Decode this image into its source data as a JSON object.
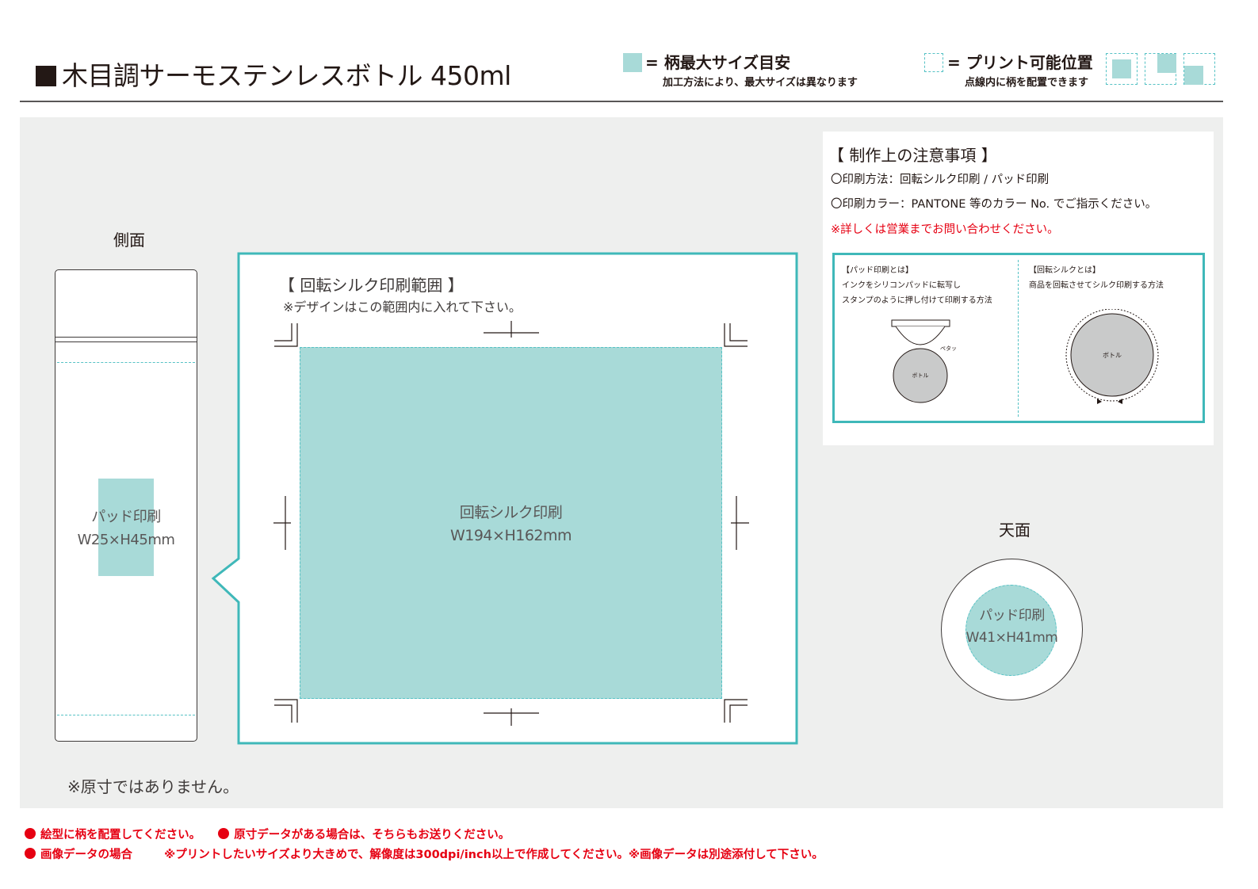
{
  "header": {
    "title": "木目調サーモステンレスボトル 450ml",
    "legend_max_size": "= 柄最大サイズ目安",
    "legend_max_size_note": "加工方法により、最大サイズは異なります",
    "legend_print_position": "= プリント可能位置",
    "legend_print_position_note": "点線内に柄を配置できます"
  },
  "side_view": {
    "label": "側面",
    "print_name": "パッド印刷",
    "print_size": "W25×H45mm"
  },
  "rotary_panel": {
    "title": "【 回転シルク印刷範囲 】",
    "subtitle": "※デザインはこの範囲内に入れて下さい。",
    "print_name": "回転シルク印刷",
    "print_size": "W194×H162mm"
  },
  "notes": {
    "title": "【 制作上の注意事項 】",
    "method": "〇印刷方法：回転シルク印刷 / パッド印刷",
    "color": "〇印刷カラー：PANTONE 等のカラー No. でご指示ください。",
    "contact": "※詳しくは営業までお問い合わせください。"
  },
  "info_box": {
    "pad_title": "【パッド印刷とは】",
    "pad_line1": "インクをシリコンパッドに転写し",
    "pad_line2": "スタンプのように押し付けて印刷する方法",
    "pad_sound": "ペタッ",
    "pad_bottle": "ボトル",
    "rotary_title": "【回転シルクとは】",
    "rotary_line1": "商品を回転させてシルク印刷する方法",
    "rotary_bottle": "ボトル"
  },
  "top_view": {
    "label": "天面",
    "print_name": "パッド印刷",
    "print_size": "W41×H41mm"
  },
  "disclaimer": "※原寸ではありません。",
  "footer": {
    "line1_a": "絵型に柄を配置してください。",
    "line1_b": "原寸データがある場合は、そちらもお送りください。",
    "line2_a": "画像データの場合",
    "line2_b": "※プリントしたいサイズより大きめで、解像度は300dpi/inch以上で作成してください。※画像データは別途添付して下さい。"
  },
  "colors": {
    "print_area": "#a8dad8",
    "accent_teal": "#3fb8b9",
    "dashed_teal": "#56c2c5",
    "warning_red": "#e60012",
    "background_gray": "#eeefee"
  }
}
